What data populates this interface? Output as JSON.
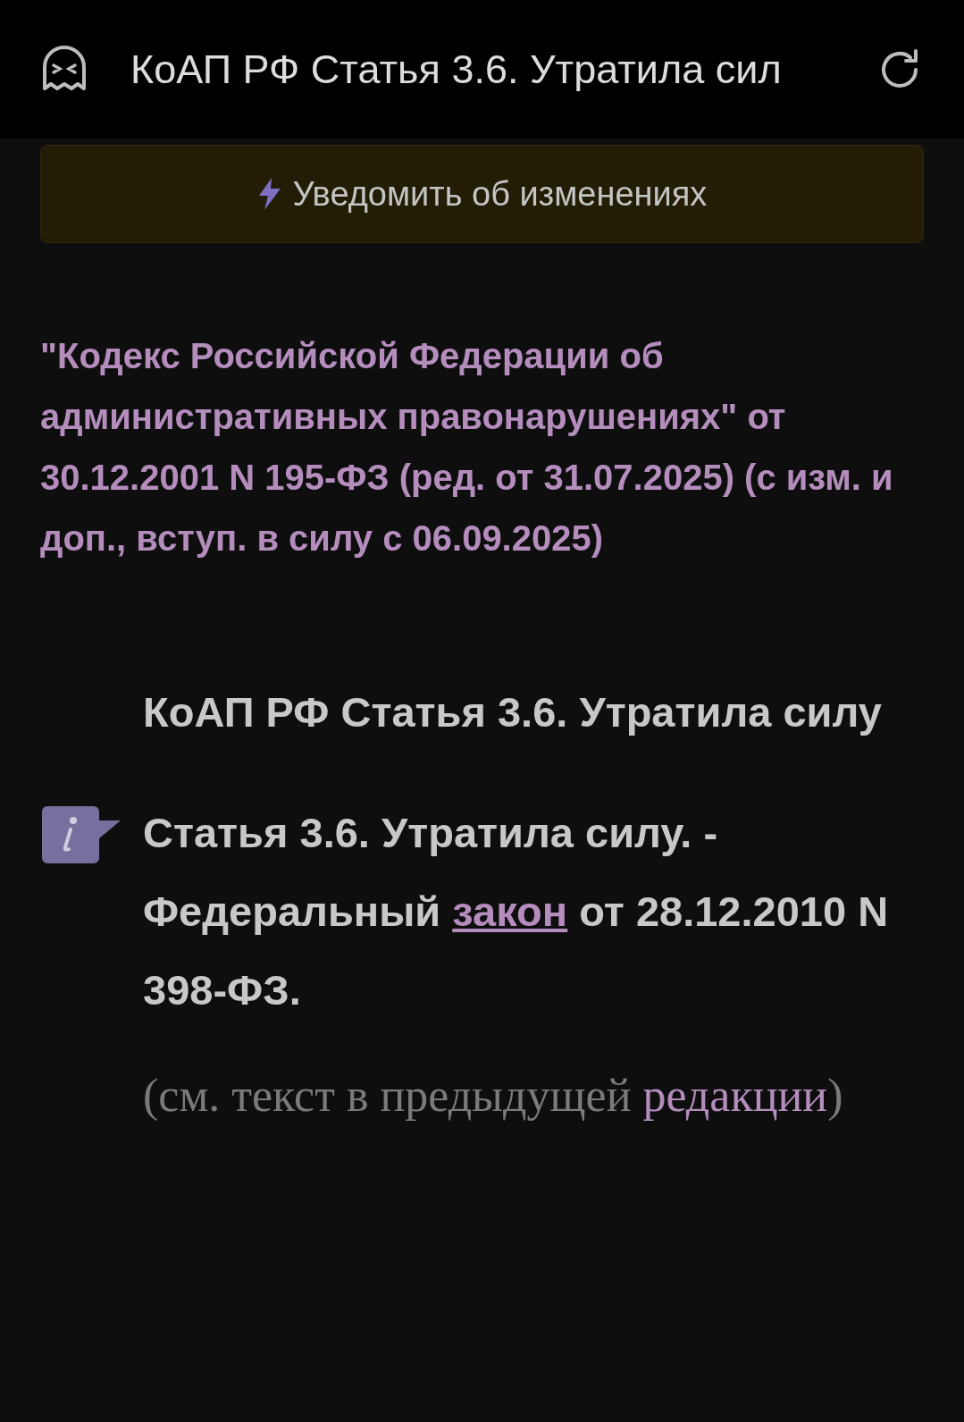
{
  "top_bar": {
    "title": "КоАП РФ Статья 3.6. Утратила сил"
  },
  "notify_button": {
    "label": "Уведомить об изменениях"
  },
  "document_title": "\"Кодекс Российской Федерации об административных правонарушениях\" от 30.12.2001 N 195-ФЗ (ред. от 31.07.2025) (с изм. и доп., вступ. в силу с 06.09.2025)",
  "article_heading": "КоАП РФ Статья 3.6. Утратила силу",
  "article_note": {
    "parts": [
      {
        "kind": "text",
        "text": "Статья 3.6. Утратила силу. - Федеральный "
      },
      {
        "kind": "link",
        "text": "закон"
      },
      {
        "kind": "text",
        "text": " от 28.12.2010 N 398-ФЗ."
      }
    ]
  },
  "previous_edition": {
    "parts": [
      {
        "kind": "text",
        "text": "(см. текст в предыдущей "
      },
      {
        "kind": "link",
        "text": "редакции"
      },
      {
        "kind": "text",
        "text": ")"
      }
    ]
  }
}
